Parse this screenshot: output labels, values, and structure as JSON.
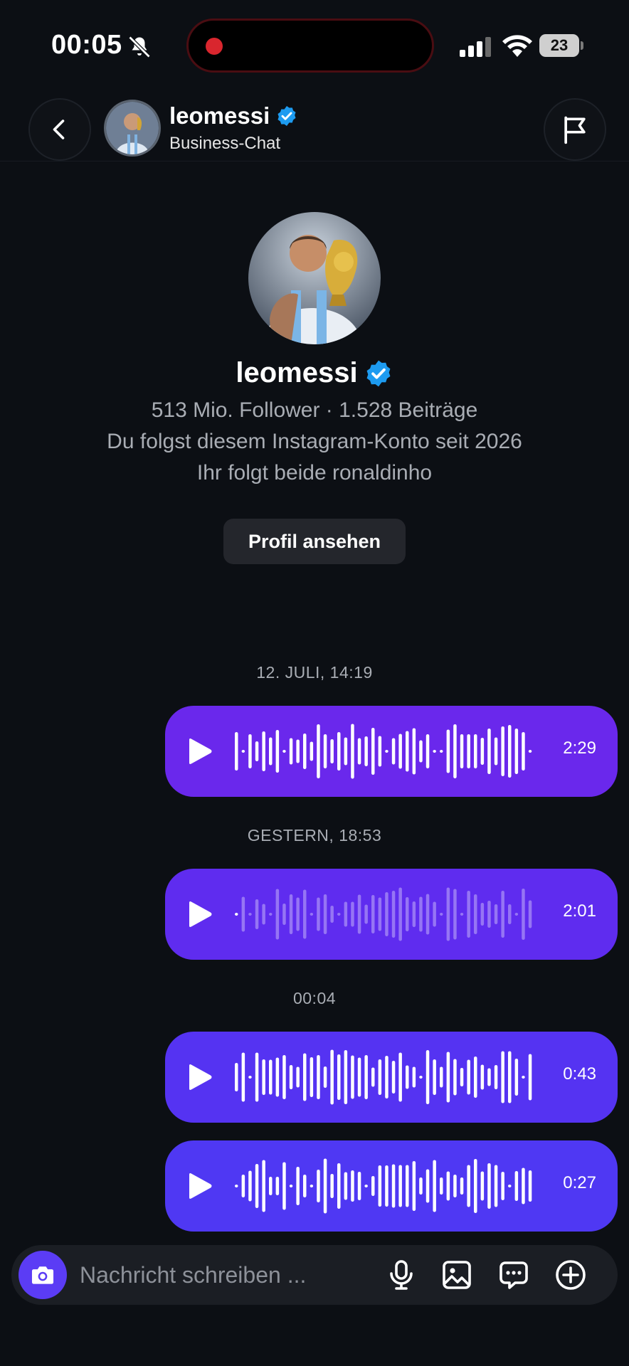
{
  "status_bar": {
    "time": "00:05",
    "battery": "23"
  },
  "header": {
    "name": "leomessi",
    "subtitle": "Business-Chat"
  },
  "profile": {
    "name": "leomessi",
    "stats": "513 Mio. Follower · 1.528 Beiträge",
    "follow_since": "Du folgst diesem Instagram-Konto seit 2026",
    "mutual": "Ihr folgt beide ronaldinho",
    "view_button": "Profil ansehen"
  },
  "messages": [
    {
      "timestamp": "12. JULI, 14:19",
      "duration": "2:29",
      "played": false,
      "color": "#6a28ec"
    },
    {
      "timestamp": "GESTERN, 18:53",
      "duration": "2:01",
      "played": true,
      "color": "#5f2cef"
    },
    {
      "timestamp": "00:04",
      "duration": "0:43",
      "played": false,
      "color": "#5533f2"
    },
    {
      "timestamp": "",
      "duration": "0:27",
      "played": false,
      "color": "#4f38f3"
    }
  ],
  "composer": {
    "placeholder": "Nachricht schreiben ...",
    "icons": [
      "camera-icon",
      "microphone-icon",
      "gallery-icon",
      "sticker-chat-icon",
      "plus-icon"
    ]
  },
  "colors": {
    "background": "#0c0f14",
    "verified": "#1d9bf0",
    "accent": "#5b3cf5"
  }
}
